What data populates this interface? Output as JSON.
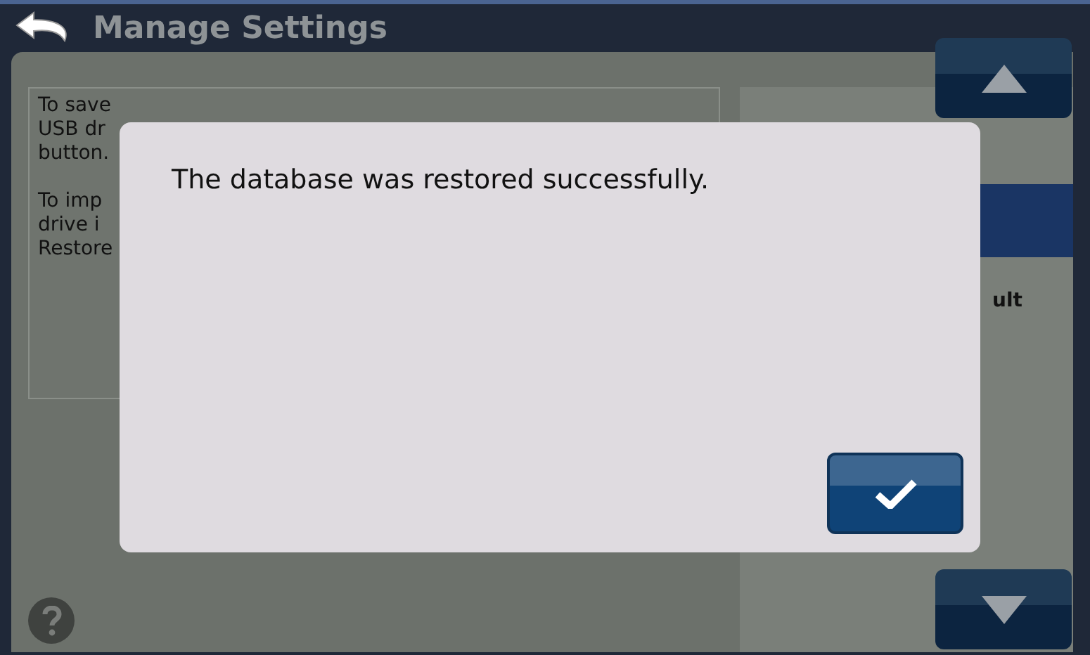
{
  "header": {
    "title": "Manage Settings"
  },
  "info_text": {
    "paragraphs": [
      [
        "To save",
        "USB dr",
        "button."
      ],
      [
        "To imp",
        "drive i",
        "Restore"
      ]
    ]
  },
  "list": {
    "items": [
      {
        "selected": false
      },
      {
        "selected": true
      },
      {
        "label": "ult",
        "selected": false
      }
    ]
  },
  "dialog": {
    "message": "The database was restored successfully."
  }
}
